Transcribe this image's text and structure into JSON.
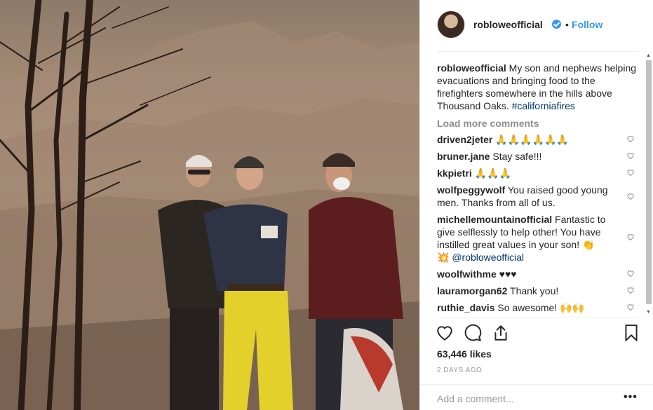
{
  "post": {
    "username": "robloweofficial",
    "follow_label": "Follow",
    "dot": "•",
    "caption_user": "robloweofficial",
    "caption_text": " My son and nephews helping evacuations and bringing food to the firefighters somewhere in the hills above Thousand Oaks. ",
    "caption_hashtag": "#californiafires",
    "load_more": "Load more comments",
    "likes": "63,446 likes",
    "time_ago": "2 DAYS AGO",
    "add_comment_placeholder": "Add a comment...",
    "more_label": "•••"
  },
  "comments": [
    {
      "user": "driven2jeter",
      "text": " 🙏🙏🙏🙏🙏🙏"
    },
    {
      "user": "bruner.jane",
      "text": " Stay safe!!!"
    },
    {
      "user": "kkpietri",
      "text": " 🙏🙏🙏"
    },
    {
      "user": "wolfpeggywolf",
      "text": " You raised good young men. Thanks from all of us."
    },
    {
      "user": "michellemountainofficial",
      "text": " Fantastic to give selflessly to help other! You have instilled great values in your son! 👏 ",
      "mention_prefix": "💥 ",
      "mention": "@robloweofficial"
    },
    {
      "user": "woolfwithme",
      "text": " ♥♥♥"
    },
    {
      "user": "lauramorgan62",
      "text": " Thank you!"
    },
    {
      "user": "ruthie_davis",
      "text": " So awesome! 🙌🙌"
    }
  ],
  "icons": {
    "verified": "verified-badge-icon",
    "like": "heart-icon",
    "comment": "comment-bubble-icon",
    "share": "share-icon",
    "save": "bookmark-icon",
    "comment_like": "small-heart-icon"
  },
  "colors": {
    "link_blue": "#3897f0",
    "hashtag": "#003569",
    "muted": "#8e8e8e"
  }
}
